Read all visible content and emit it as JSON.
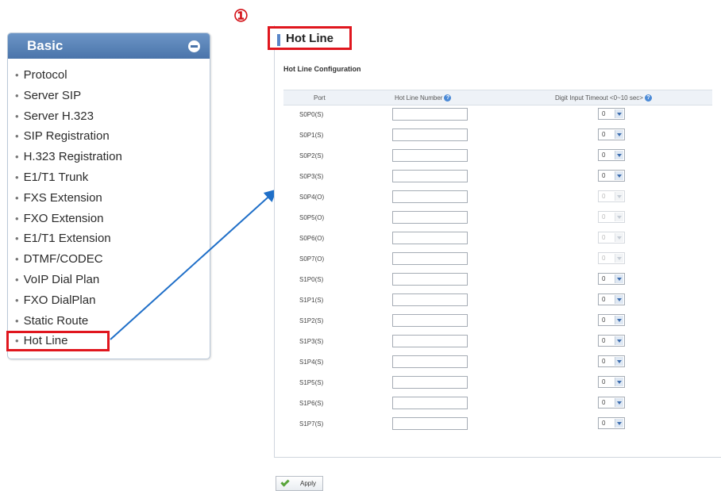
{
  "annotation": {
    "step_marker": "①",
    "accent_color": "#e0161e"
  },
  "sidebar": {
    "title": "Basic",
    "collapse_icon": "minus-circle-icon",
    "items": [
      {
        "label": "Protocol"
      },
      {
        "label": "Server SIP"
      },
      {
        "label": "Server H.323"
      },
      {
        "label": "SIP Registration"
      },
      {
        "label": "H.323 Registration"
      },
      {
        "label": "E1/T1 Trunk"
      },
      {
        "label": "FXS Extension"
      },
      {
        "label": "FXO Extension"
      },
      {
        "label": "E1/T1 Extension"
      },
      {
        "label": "DTMF/CODEC"
      },
      {
        "label": "VoIP Dial Plan"
      },
      {
        "label": "FXO DialPlan"
      },
      {
        "label": "Static Route"
      },
      {
        "label": "Hot Line",
        "highlighted": true
      }
    ]
  },
  "main": {
    "title": "Hot Line",
    "section_title": "Hot Line Configuration",
    "columns": {
      "port": "Port",
      "number": "Hot Line Number",
      "timeout": "Digit Input Timeout <0~10 sec>"
    },
    "rows": [
      {
        "port": "S0P0(S)",
        "number": "",
        "timeout": "0",
        "disabled": false
      },
      {
        "port": "S0P1(S)",
        "number": "",
        "timeout": "0",
        "disabled": false
      },
      {
        "port": "S0P2(S)",
        "number": "",
        "timeout": "0",
        "disabled": false
      },
      {
        "port": "S0P3(S)",
        "number": "",
        "timeout": "0",
        "disabled": false
      },
      {
        "port": "S0P4(O)",
        "number": "",
        "timeout": "0",
        "disabled": true
      },
      {
        "port": "S0P5(O)",
        "number": "",
        "timeout": "0",
        "disabled": true
      },
      {
        "port": "S0P6(O)",
        "number": "",
        "timeout": "0",
        "disabled": true
      },
      {
        "port": "S0P7(O)",
        "number": "",
        "timeout": "0",
        "disabled": true
      },
      {
        "port": "S1P0(S)",
        "number": "",
        "timeout": "0",
        "disabled": false
      },
      {
        "port": "S1P1(S)",
        "number": "",
        "timeout": "0",
        "disabled": false
      },
      {
        "port": "S1P2(S)",
        "number": "",
        "timeout": "0",
        "disabled": false
      },
      {
        "port": "S1P3(S)",
        "number": "",
        "timeout": "0",
        "disabled": false
      },
      {
        "port": "S1P4(S)",
        "number": "",
        "timeout": "0",
        "disabled": false
      },
      {
        "port": "S1P5(S)",
        "number": "",
        "timeout": "0",
        "disabled": false
      },
      {
        "port": "S1P6(S)",
        "number": "",
        "timeout": "0",
        "disabled": false
      },
      {
        "port": "S1P7(S)",
        "number": "",
        "timeout": "0",
        "disabled": false
      }
    ],
    "apply_label": "Apply"
  }
}
